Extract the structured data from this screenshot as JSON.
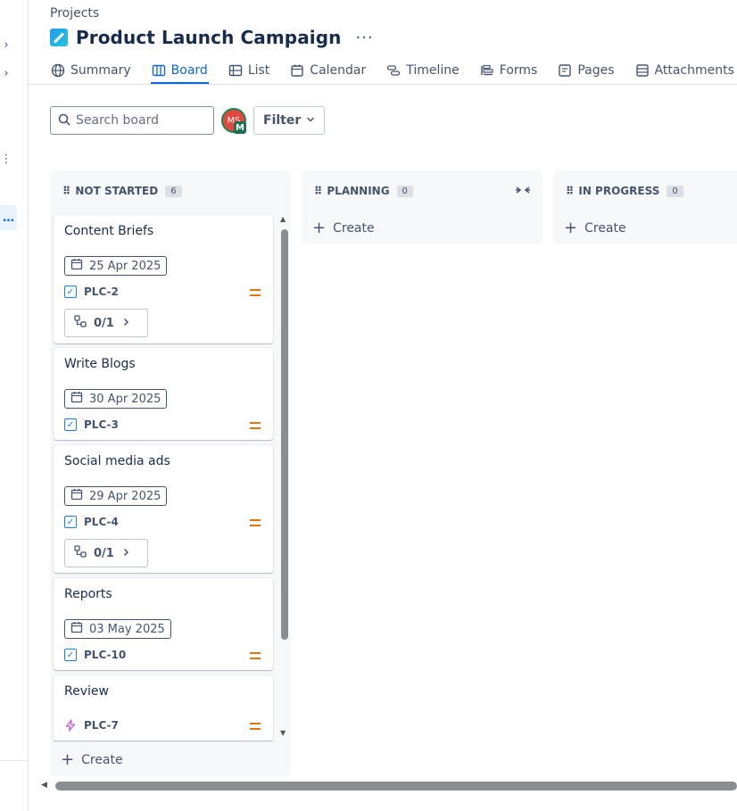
{
  "header": {
    "breadcrumb": "Projects",
    "title": "Product Launch Campaign",
    "more": "···"
  },
  "tabs": [
    {
      "label": "Summary",
      "icon": "globe-icon"
    },
    {
      "label": "Board",
      "icon": "board-icon",
      "active": true
    },
    {
      "label": "List",
      "icon": "list-icon"
    },
    {
      "label": "Calendar",
      "icon": "calendar-icon"
    },
    {
      "label": "Timeline",
      "icon": "timeline-icon"
    },
    {
      "label": "Forms",
      "icon": "forms-icon"
    },
    {
      "label": "Pages",
      "icon": "pages-icon"
    },
    {
      "label": "Attachments",
      "icon": "attachments-icon"
    }
  ],
  "toolbar": {
    "search_placeholder": "Search board",
    "avatar_initials": "MS",
    "avatar_badge": "M",
    "filter_label": "Filter"
  },
  "columns": [
    {
      "name": "NOT STARTED",
      "count": "6",
      "create_label": "Create",
      "cards": [
        {
          "title": "Content Briefs",
          "date": "25 Apr 2025",
          "key": "PLC-2",
          "type": "task",
          "children": "0/1"
        },
        {
          "title": "Write Blogs",
          "date": "30 Apr 2025",
          "key": "PLC-3",
          "type": "task"
        },
        {
          "title": "Social media ads",
          "date": "29 Apr 2025",
          "key": "PLC-4",
          "type": "task",
          "children": "0/1"
        },
        {
          "title": "Reports",
          "date": "03 May 2025",
          "key": "PLC-10",
          "type": "task"
        },
        {
          "title": "Review",
          "key": "PLC-7",
          "type": "epic"
        }
      ]
    },
    {
      "name": "PLANNING",
      "count": "0",
      "create_label": "Create"
    },
    {
      "name": "IN PROGRESS",
      "count": "0",
      "create_label": "Create"
    }
  ],
  "colors": {
    "accent": "#0c66e4",
    "priority_medium": "#e2740e",
    "task_blue": "#1d7afc",
    "epic_purple": "#c25bd8"
  }
}
